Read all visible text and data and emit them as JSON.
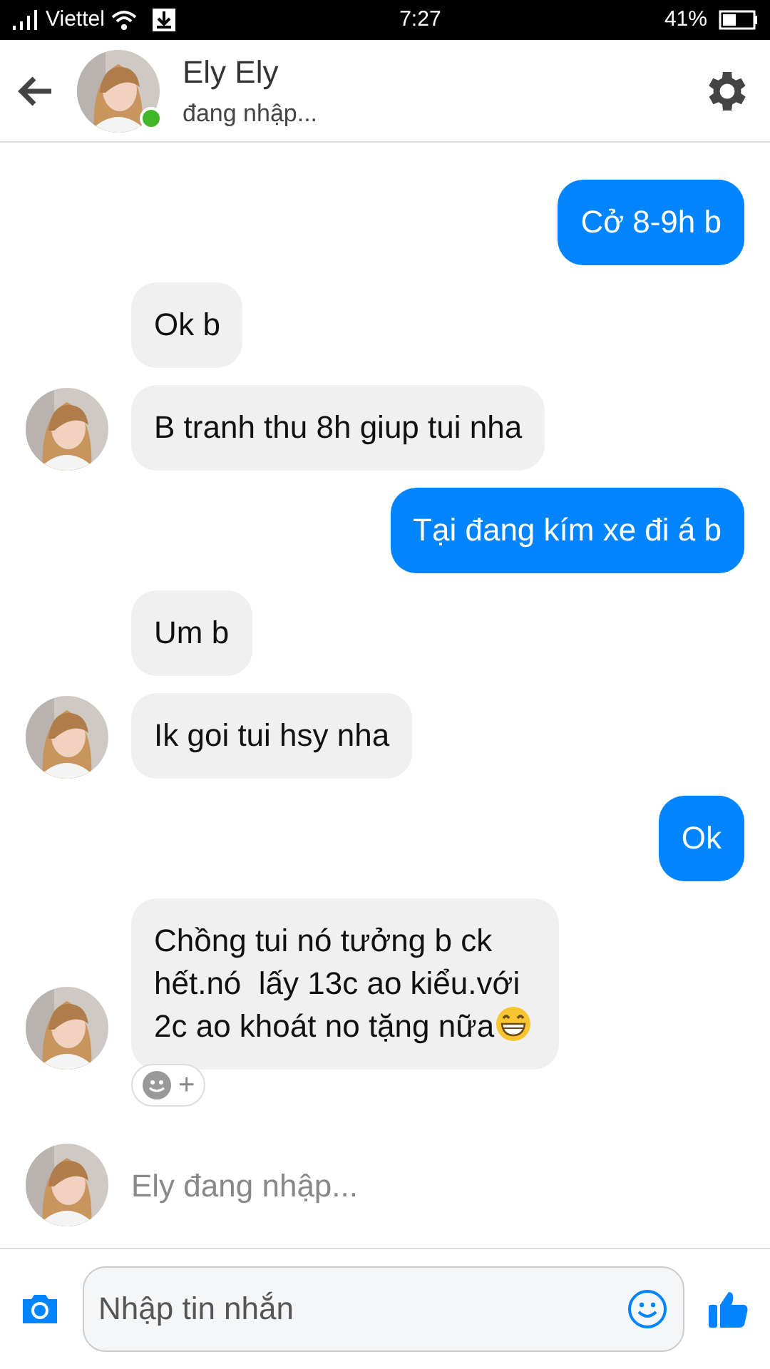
{
  "status_bar": {
    "carrier": "Viettel",
    "time": "7:27",
    "battery": "41%"
  },
  "header": {
    "name": "Ely Ely",
    "status": "đang nhập...",
    "online": true
  },
  "messages": [
    {
      "kind": "sent",
      "text": "Cở 8-9h b"
    },
    {
      "kind": "received",
      "text": "Ok b",
      "avatar": false
    },
    {
      "kind": "received",
      "text": "B tranh thu 8h giup tui nha",
      "avatar": true
    },
    {
      "kind": "sent",
      "text": "Tại đang kím xe đi á b"
    },
    {
      "kind": "received",
      "text": "Um b",
      "avatar": false
    },
    {
      "kind": "received",
      "text": "Ik goi tui hsy nha",
      "avatar": true
    },
    {
      "kind": "sent",
      "text": "Ok"
    },
    {
      "kind": "received",
      "text": "Chồng tui nó tưởng b ck hết.nó  lấy 13c ao kiểu.với 2c ao khoát no tặng nữa",
      "avatar": true,
      "emoji": true,
      "reaction_button": "+"
    }
  ],
  "typing": "Ely đang nhập...",
  "composer": {
    "placeholder": "Nhập tin nhắn"
  }
}
